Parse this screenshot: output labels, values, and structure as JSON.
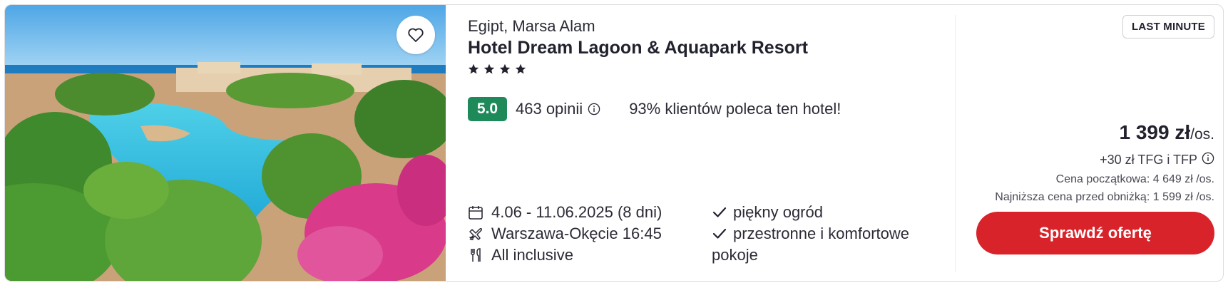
{
  "hotel": {
    "location": "Egipt, Marsa Alam",
    "name": "Hotel Dream Lagoon & Aquapark Resort",
    "stars": 4
  },
  "rating": {
    "score": "5.0",
    "reviews": "463 opinii",
    "recommend": "93% klientów poleca ten hotel!"
  },
  "details": {
    "dates": "4.06 - 11.06.2025 (8 dni)",
    "flight": "Warszawa-Okęcie 16:45",
    "board": "All inclusive"
  },
  "features": [
    "piękny ogród",
    "przestronne i komfortowe pokoje"
  ],
  "price": {
    "badge": "LAST MINUTE",
    "amount": "1 399 zł",
    "unit": "/os.",
    "fees": "+30 zł TFG i TFP",
    "initial": "Cena początkowa: 4 649 zł /os.",
    "lowest": "Najniższa cena przed obniżką: 1 599 zł /os.",
    "cta": "Sprawdź ofertę"
  },
  "icons": {
    "favorite": "heart-icon",
    "star": "star-icon",
    "info": "info-icon",
    "calendar": "calendar-icon",
    "flight": "plane-icon",
    "board": "cutlery-icon",
    "check": "check-icon"
  },
  "colors": {
    "rating_badge": "#1e8a5a",
    "cta": "#d8232a",
    "text": "#22222e"
  }
}
